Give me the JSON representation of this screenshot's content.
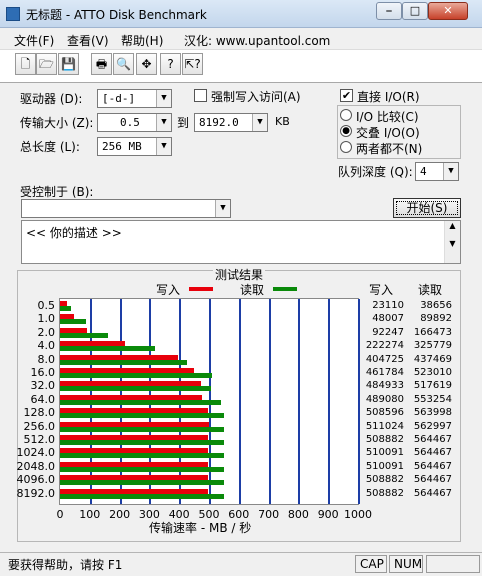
{
  "window": {
    "title": "无标题 - ATTO Disk Benchmark",
    "min": "⎯",
    "max": "□",
    "close": "✕"
  },
  "menu": [
    "文件(F)",
    "查看(V)",
    "帮助(H)",
    "汉化: www.upantool.com"
  ],
  "toolbar": {
    "icons": [
      "new-file-icon",
      "open-folder-icon",
      "save-icon",
      "print-icon",
      "print-preview-icon",
      "move-icon",
      "help-icon",
      "context-help-icon"
    ],
    "glyphs": [
      "🗋",
      "🗁",
      "💾",
      "🖶",
      "🔍",
      "✥",
      "?",
      "⇱?"
    ]
  },
  "form": {
    "drive_label": "驱动器 (D):",
    "drive_value": "[-d-]",
    "force_write_label": "强制写入访问(A)",
    "direct_io_label": "直接 I/O(R)",
    "transfer_label": "传输大小 (Z):",
    "transfer_from": "0.5",
    "to_label": "到",
    "transfer_to": "8192.0",
    "kb_label": "KB",
    "length_label": "总长度 (L):",
    "length_value": "256 MB",
    "radio": [
      "I/O 比较(C)",
      "交叠 I/O(O)",
      "两者都不(N)"
    ],
    "queue_label": "队列深度 (Q):",
    "queue_value": "4",
    "controlled_label": "受控制于 (B):",
    "controlled_value": "",
    "start_button": "开始(S)",
    "description": "<<   你的描述   >>"
  },
  "results": {
    "title": "测试结果",
    "legend_write": "写入",
    "legend_read": "读取",
    "col_write": "写入",
    "col_read": "读取",
    "xaxis_label": "传输速率 - MB / 秒"
  },
  "chart_data": {
    "type": "bar",
    "orientation": "horizontal",
    "categories": [
      "0.5",
      "1.0",
      "2.0",
      "4.0",
      "8.0",
      "16.0",
      "32.0",
      "64.0",
      "128.0",
      "256.0",
      "512.0",
      "1024.0",
      "2048.0",
      "4096.0",
      "8192.0"
    ],
    "series": [
      {
        "name": "写入",
        "color": "#e8000b",
        "values": [
          23110,
          48007,
          92247,
          222274,
          404725,
          461784,
          484933,
          489080,
          508596,
          511024,
          508882,
          510091,
          510091,
          508882,
          508882
        ]
      },
      {
        "name": "读取",
        "color": "#0a8a0a",
        "values": [
          38656,
          89892,
          166473,
          325779,
          437469,
          523010,
          517619,
          553254,
          563998,
          562997,
          564467,
          564467,
          564467,
          564467,
          564467
        ]
      }
    ],
    "x_ticks": [
      "0",
      "100",
      "200",
      "300",
      "400",
      "500",
      "600",
      "700",
      "800",
      "900",
      "1000"
    ],
    "xlim": [
      0,
      1000
    ],
    "grid": "vertical",
    "legend": "top"
  },
  "status": {
    "help": "要获得帮助，请按 F1",
    "cap": "CAP",
    "num": "NUM"
  }
}
